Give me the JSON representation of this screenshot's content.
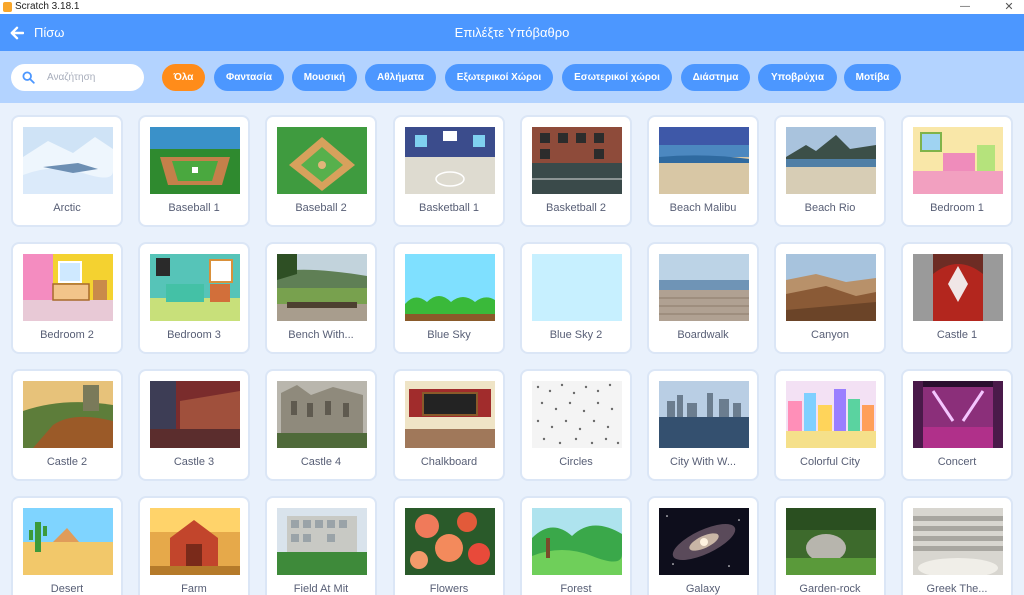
{
  "window": {
    "title": "Scratch 3.18.1",
    "minimize_glyph": "—",
    "close_glyph": "✕"
  },
  "header": {
    "back_label": "Πίσω",
    "title": "Επιλέξτε Υπόβαθρο",
    "back_icon": "arrow-left-icon"
  },
  "search": {
    "placeholder": "Αναζήτηση",
    "value": "",
    "icon": "search-icon"
  },
  "colors": {
    "header": "#4c97ff",
    "filter_bar": "#b3d3ff",
    "active_tag": "#ff8c1a",
    "tag": "#4c97ff",
    "text": "#575e75"
  },
  "tags": [
    {
      "label": "Όλα",
      "active": true
    },
    {
      "label": "Φαντασία",
      "active": false
    },
    {
      "label": "Μουσική",
      "active": false
    },
    {
      "label": "Αθλήματα",
      "active": false
    },
    {
      "label": "Εξωτερικοί Χώροι",
      "active": false
    },
    {
      "label": "Εσωτερικοί χώροι",
      "active": false
    },
    {
      "label": "Διάστημα",
      "active": false
    },
    {
      "label": "Υποβρύχια",
      "active": false
    },
    {
      "label": "Μοτίβα",
      "active": false
    }
  ],
  "backdrops": [
    {
      "name": "Arctic"
    },
    {
      "name": "Baseball 1"
    },
    {
      "name": "Baseball 2"
    },
    {
      "name": "Basketball 1"
    },
    {
      "name": "Basketball 2"
    },
    {
      "name": "Beach Malibu"
    },
    {
      "name": "Beach Rio"
    },
    {
      "name": "Bedroom 1"
    },
    {
      "name": "Bedroom 2"
    },
    {
      "name": "Bedroom 3"
    },
    {
      "name": "Bench With..."
    },
    {
      "name": "Blue Sky"
    },
    {
      "name": "Blue Sky 2"
    },
    {
      "name": "Boardwalk"
    },
    {
      "name": "Canyon"
    },
    {
      "name": "Castle 1"
    },
    {
      "name": "Castle 2"
    },
    {
      "name": "Castle 3"
    },
    {
      "name": "Castle 4"
    },
    {
      "name": "Chalkboard"
    },
    {
      "name": "Circles"
    },
    {
      "name": "City With W..."
    },
    {
      "name": "Colorful City"
    },
    {
      "name": "Concert"
    },
    {
      "name": "Desert"
    },
    {
      "name": "Farm"
    },
    {
      "name": "Field At Mit"
    },
    {
      "name": "Flowers"
    },
    {
      "name": "Forest"
    },
    {
      "name": "Galaxy"
    },
    {
      "name": "Garden-rock"
    },
    {
      "name": "Greek The..."
    }
  ]
}
